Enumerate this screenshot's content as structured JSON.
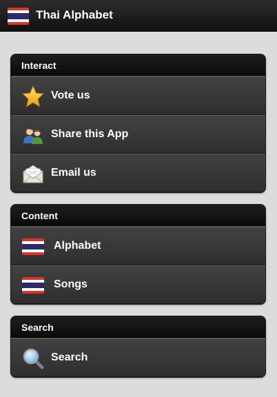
{
  "header": {
    "title": "Thai Alphabet",
    "flag_icon": "thai-flag-icon"
  },
  "sections": [
    {
      "title": "Interact",
      "items": [
        {
          "label": "Vote us",
          "icon": "star-icon"
        },
        {
          "label": "Share this App",
          "icon": "people-icon"
        },
        {
          "label": "Email us",
          "icon": "envelope-icon"
        }
      ]
    },
    {
      "title": "Content",
      "items": [
        {
          "label": "Alphabet",
          "icon": "thai-flag-icon"
        },
        {
          "label": "Songs",
          "icon": "thai-flag-icon"
        }
      ]
    },
    {
      "title": "Search",
      "items": [
        {
          "label": "Search",
          "icon": "magnifier-icon"
        }
      ]
    }
  ],
  "colors": {
    "flag_red": "#d9352b",
    "flag_white": "#ffffff",
    "flag_blue": "#2d2a6b",
    "background": "#dcdcdc"
  }
}
